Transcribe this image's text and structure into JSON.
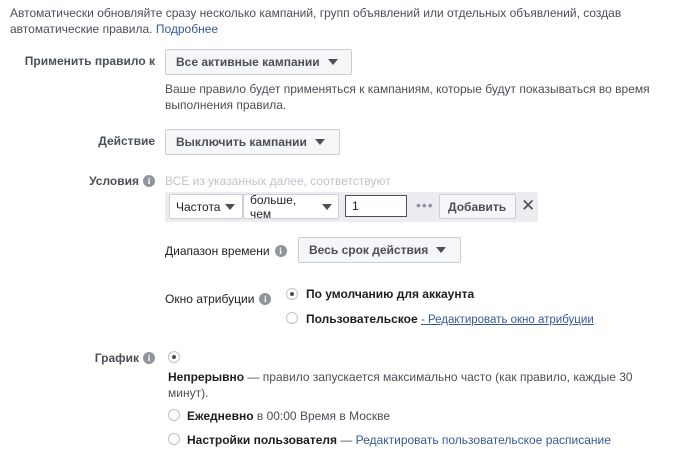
{
  "intro": {
    "text": "Автоматически обновляйте сразу несколько кампаний, групп объявлений или отдельных объявлений, создав автоматические правила.",
    "link": "Подробнее"
  },
  "apply_rule": {
    "label": "Применить правило к",
    "dropdown_value": "Все активные кампании",
    "help": "Ваше правило будет применяться к кампаниям, которые будут показываться во время выполнения правила."
  },
  "action": {
    "label": "Действие",
    "dropdown_value": "Выключить кампании"
  },
  "conditions": {
    "label": "Условия",
    "match_text": "ВСЕ из указанных далее, соответствуют",
    "metric": "Частота",
    "operator": "больше, чем",
    "value": "1",
    "add_label": "Добавить",
    "remove_icon": "close-icon"
  },
  "time_range": {
    "label": "Диапазон времени",
    "dropdown_value": "Весь срок действия"
  },
  "attribution": {
    "label": "Окно атрибуции",
    "options": [
      {
        "label": "По умолчанию для аккаунта",
        "selected": true
      },
      {
        "label": "Пользовательское",
        "link": "- Редактировать окно атрибуции",
        "selected": false
      }
    ]
  },
  "schedule": {
    "label": "График",
    "continuous": {
      "title": "Непрерывно",
      "desc": " — правило запускается максимально часто (как правило, каждые 30 минут).",
      "selected": true
    },
    "daily": {
      "title": "Ежедневно",
      "desc": " в 00:00 Время в Москве",
      "selected": false
    },
    "custom": {
      "title": "Настройки пользователя",
      "dash": " — ",
      "link": "Редактировать пользовательское расписание",
      "selected": false
    }
  },
  "colors": {
    "link": "#365899",
    "label": "#4b4f56",
    "border": "#ccd0d5",
    "button_bg": "#f5f6f7"
  }
}
